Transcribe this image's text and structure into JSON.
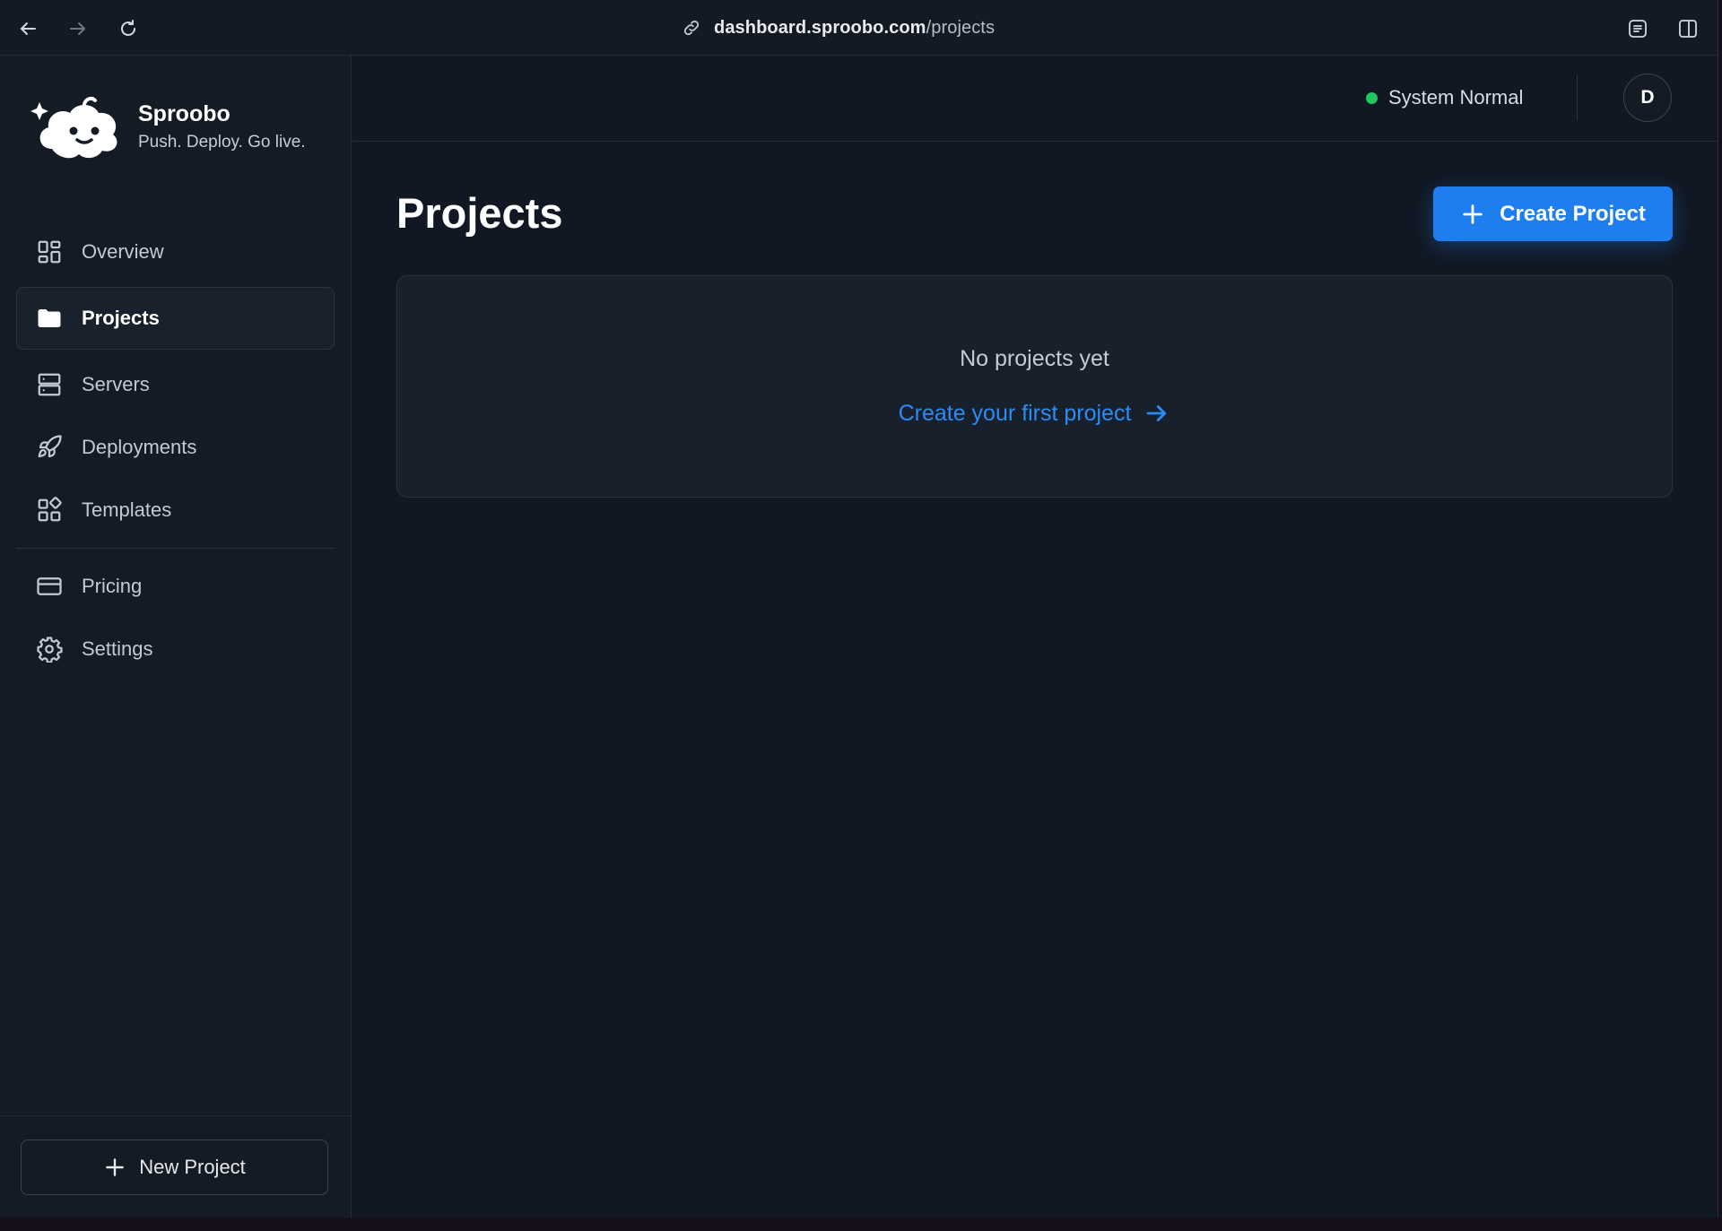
{
  "browser": {
    "url_host": "dashboard.sproobo.com",
    "url_path": "/projects"
  },
  "brand": {
    "name": "Sproobo",
    "tagline": "Push. Deploy. Go live."
  },
  "sidebar": {
    "items": [
      {
        "label": "Overview",
        "icon": "grid-icon"
      },
      {
        "label": "Projects",
        "icon": "folder-icon",
        "active": true
      },
      {
        "label": "Servers",
        "icon": "server-icon"
      },
      {
        "label": "Deployments",
        "icon": "rocket-icon"
      },
      {
        "label": "Templates",
        "icon": "templates-icon"
      },
      {
        "label": "Pricing",
        "icon": "credit-card-icon"
      },
      {
        "label": "Settings",
        "icon": "gear-icon"
      }
    ],
    "new_project_label": "New Project"
  },
  "topbar": {
    "status_text": "System Normal",
    "status_color": "#22c55e",
    "avatar_initial": "D"
  },
  "main": {
    "title": "Projects",
    "create_button_label": "Create Project",
    "empty_state": {
      "message": "No projects yet",
      "link_label": "Create your first project"
    }
  },
  "colors": {
    "accent": "#1e7ef0",
    "link": "#2b8cf3",
    "background": "#111823"
  }
}
